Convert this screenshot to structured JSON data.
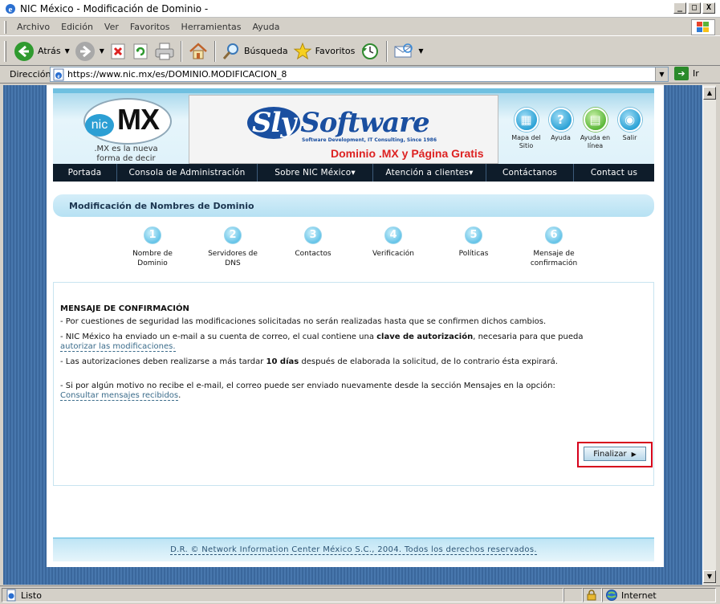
{
  "window": {
    "title": "NIC México - Modificación de Dominio -",
    "buttons": [
      "_",
      "□",
      "X"
    ]
  },
  "menu": [
    "Archivo",
    "Edición",
    "Ver",
    "Favoritos",
    "Herramientas",
    "Ayuda"
  ],
  "toolbar": {
    "back": "Atrás",
    "search": "Búsqueda",
    "favorites": "Favoritos"
  },
  "address": {
    "label": "Dirección",
    "url": "https://www.nic.mx/es/DOMINIO.MODIFICACION_8",
    "go": "Ir"
  },
  "header": {
    "logo_nic": "nic",
    "logo_mx": "MX",
    "tagline": ".MX es la nueva forma de decir México",
    "banner_brand_a": "Sly",
    "banner_brand_b": "Software",
    "banner_sub": "Software Development, IT Consulting, Since 1986",
    "banner_promo": "Dominio .MX y Página Gratis",
    "icons": [
      {
        "label": "Mapa del Sitio",
        "glyph": "▦"
      },
      {
        "label": "Ayuda",
        "glyph": "?"
      },
      {
        "label": "Ayuda en línea",
        "glyph": "▤"
      },
      {
        "label": "Salir",
        "glyph": "◉"
      }
    ]
  },
  "nav": [
    "Portada",
    "Consola de Administración",
    "Sobre NIC México▾",
    "Atención a clientes▾",
    "Contáctanos",
    "Contact us"
  ],
  "section_title": "Modificación de Nombres de Dominio",
  "steps": [
    {
      "num": "1",
      "label": "Nombre de Dominio"
    },
    {
      "num": "2",
      "label": "Servidores de DNS"
    },
    {
      "num": "3",
      "label": "Contactos"
    },
    {
      "num": "4",
      "label": "Verificación"
    },
    {
      "num": "5",
      "label": "Políticas"
    },
    {
      "num": "6",
      "label": "Mensaje de confirmación"
    }
  ],
  "content": {
    "heading": "MENSAJE DE CONFIRMACIÓN",
    "p1": "- Por cuestiones de seguridad las modificaciones solicitadas no serán realizadas hasta que se confirmen dichos cambios.",
    "p2_a": "- NIC México ha enviado un e-mail a su cuenta de correo, el cual contiene una ",
    "p2_b": "clave de autorización",
    "p2_c": ", necesaria para que pueda ",
    "p2_link": "autorizar las modificaciones.",
    "p3_a": "- Las autorizaciones deben realizarse a más tardar ",
    "p3_b": "10 días",
    "p3_c": " después de elaborada la solicitud, de lo contrario ésta expirará.",
    "p4": "- Si por algún motivo no recibe el e-mail, el correo puede ser enviado nuevamente desde la sección Mensajes en la opción:",
    "p4_link": "Consultar mensajes recibidos",
    "finish": "Finalizar"
  },
  "footer": "D.R. © Network Information Center México S.C., 2004. Todos los derechos reservados.",
  "status": {
    "text": "Listo",
    "zone": "Internet"
  }
}
